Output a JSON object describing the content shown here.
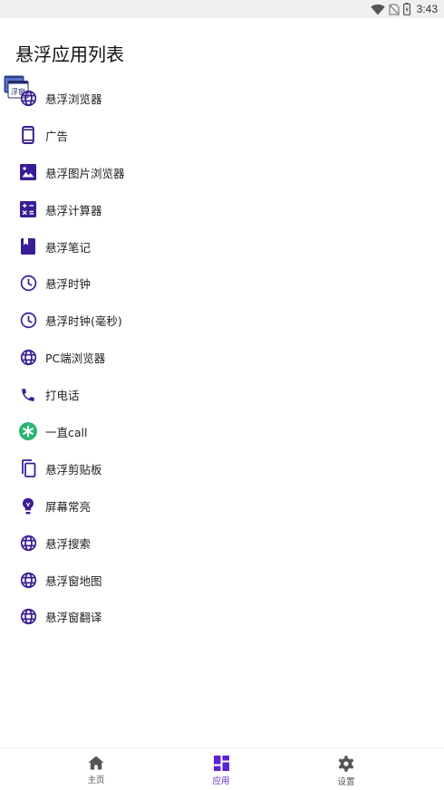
{
  "status_bar": {
    "time": "3:43",
    "icons": [
      "wifi-icon",
      "no-sim-icon",
      "battery-icon"
    ]
  },
  "page": {
    "title": "悬浮应用列表"
  },
  "floating_window": {
    "icon": "floating-window-icon",
    "text": "浮窗"
  },
  "apps": [
    {
      "label": "悬浮浏览器",
      "icon": "globe-icon"
    },
    {
      "label": "广告",
      "icon": "phone-device-icon"
    },
    {
      "label": "悬浮图片浏览器",
      "icon": "image-icon"
    },
    {
      "label": "悬浮计算器",
      "icon": "calculator-icon"
    },
    {
      "label": "悬浮笔记",
      "icon": "notebook-icon"
    },
    {
      "label": "悬浮时钟",
      "icon": "clock-icon"
    },
    {
      "label": "悬浮时钟(毫秒)",
      "icon": "clock-icon"
    },
    {
      "label": "PC端浏览器",
      "icon": "globe-icon"
    },
    {
      "label": "打电话",
      "icon": "phone-icon"
    },
    {
      "label": "一直call",
      "icon": "call-badge-icon"
    },
    {
      "label": "悬浮剪贴板",
      "icon": "clipboard-icon"
    },
    {
      "label": "屏幕常亮",
      "icon": "lightbulb-icon"
    },
    {
      "label": "悬浮搜索",
      "icon": "globe-icon"
    },
    {
      "label": "悬浮窗地图",
      "icon": "globe-icon"
    },
    {
      "label": "悬浮窗翻译",
      "icon": "globe-icon"
    }
  ],
  "bottom_nav": {
    "tabs": [
      {
        "label": "主页",
        "icon": "home-icon"
      },
      {
        "label": "应用",
        "icon": "apps-grid-icon",
        "active": true
      },
      {
        "label": "设置",
        "icon": "gear-icon"
      }
    ]
  },
  "colors": {
    "accent": "#5b23d6",
    "icon": "#3a1d96",
    "nav_icon": "#555555",
    "call_badge": "#2bb673"
  }
}
